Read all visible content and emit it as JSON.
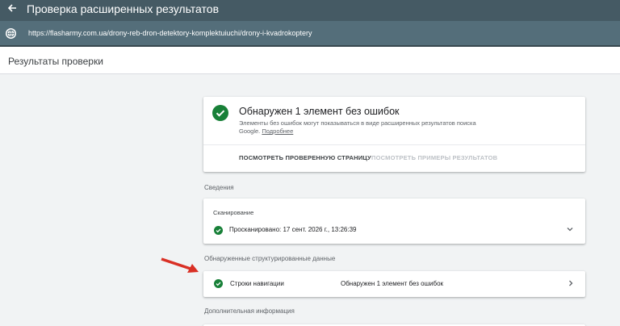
{
  "header": {
    "title": "Проверка расширенных результатов",
    "url": "https://flasharmy.com.ua/drony-reb-dron-detektory-komplektuiuchi/drony-i-kvadrokoptery"
  },
  "subheader": {
    "label": "Результаты проверки"
  },
  "summary": {
    "headline": "Обнаружен 1 элемент без ошибок",
    "description": "Элементы без ошибок могут показываться в виде расширенных результатов поиска Google.",
    "more_link": "Подробнее",
    "view_page_button": "ПОСМОТРЕТЬ ПРОВЕРЕННУЮ СТРАНИЦУ",
    "view_examples_button": "ПОСМОТРЕТЬ ПРИМЕРЫ РЕЗУЛЬТАТОВ"
  },
  "details": {
    "section_label": "Сведения",
    "crawl_label": "Сканирование",
    "crawl_text": "Просканировано: 17 сент. 2026 г., 13:26:39"
  },
  "structured": {
    "section_label": "Обнаруженные структурированные данные",
    "item_name": "Строки навигации",
    "item_status": "Обнаружен 1 элемент без ошибок"
  },
  "additional": {
    "section_label": "Дополнительная информация"
  },
  "colors": {
    "header": "#455a64",
    "url_bar": "#546e7a",
    "success": "#188038",
    "arrow": "#d93025"
  },
  "icons": [
    "back-arrow-icon",
    "globe-icon",
    "check-circle-icon",
    "chevron-down-icon",
    "chevron-right-icon",
    "annotation-arrow-icon"
  ]
}
